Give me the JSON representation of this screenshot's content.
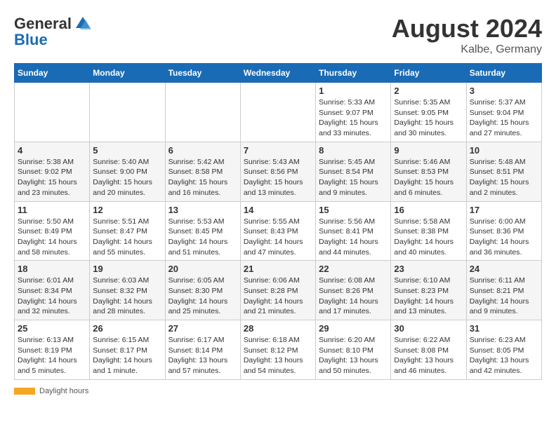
{
  "logo": {
    "general": "General",
    "blue": "Blue"
  },
  "title": "August 2024",
  "location": "Kalbe, Germany",
  "days_of_week": [
    "Sunday",
    "Monday",
    "Tuesday",
    "Wednesday",
    "Thursday",
    "Friday",
    "Saturday"
  ],
  "footer": {
    "daylight_label": "Daylight hours"
  },
  "weeks": [
    [
      {
        "day": "",
        "info": ""
      },
      {
        "day": "",
        "info": ""
      },
      {
        "day": "",
        "info": ""
      },
      {
        "day": "",
        "info": ""
      },
      {
        "day": "1",
        "info": "Sunrise: 5:33 AM\nSunset: 9:07 PM\nDaylight: 15 hours\nand 33 minutes."
      },
      {
        "day": "2",
        "info": "Sunrise: 5:35 AM\nSunset: 9:05 PM\nDaylight: 15 hours\nand 30 minutes."
      },
      {
        "day": "3",
        "info": "Sunrise: 5:37 AM\nSunset: 9:04 PM\nDaylight: 15 hours\nand 27 minutes."
      }
    ],
    [
      {
        "day": "4",
        "info": "Sunrise: 5:38 AM\nSunset: 9:02 PM\nDaylight: 15 hours\nand 23 minutes."
      },
      {
        "day": "5",
        "info": "Sunrise: 5:40 AM\nSunset: 9:00 PM\nDaylight: 15 hours\nand 20 minutes."
      },
      {
        "day": "6",
        "info": "Sunrise: 5:42 AM\nSunset: 8:58 PM\nDaylight: 15 hours\nand 16 minutes."
      },
      {
        "day": "7",
        "info": "Sunrise: 5:43 AM\nSunset: 8:56 PM\nDaylight: 15 hours\nand 13 minutes."
      },
      {
        "day": "8",
        "info": "Sunrise: 5:45 AM\nSunset: 8:54 PM\nDaylight: 15 hours\nand 9 minutes."
      },
      {
        "day": "9",
        "info": "Sunrise: 5:46 AM\nSunset: 8:53 PM\nDaylight: 15 hours\nand 6 minutes."
      },
      {
        "day": "10",
        "info": "Sunrise: 5:48 AM\nSunset: 8:51 PM\nDaylight: 15 hours\nand 2 minutes."
      }
    ],
    [
      {
        "day": "11",
        "info": "Sunrise: 5:50 AM\nSunset: 8:49 PM\nDaylight: 14 hours\nand 58 minutes."
      },
      {
        "day": "12",
        "info": "Sunrise: 5:51 AM\nSunset: 8:47 PM\nDaylight: 14 hours\nand 55 minutes."
      },
      {
        "day": "13",
        "info": "Sunrise: 5:53 AM\nSunset: 8:45 PM\nDaylight: 14 hours\nand 51 minutes."
      },
      {
        "day": "14",
        "info": "Sunrise: 5:55 AM\nSunset: 8:43 PM\nDaylight: 14 hours\nand 47 minutes."
      },
      {
        "day": "15",
        "info": "Sunrise: 5:56 AM\nSunset: 8:41 PM\nDaylight: 14 hours\nand 44 minutes."
      },
      {
        "day": "16",
        "info": "Sunrise: 5:58 AM\nSunset: 8:38 PM\nDaylight: 14 hours\nand 40 minutes."
      },
      {
        "day": "17",
        "info": "Sunrise: 6:00 AM\nSunset: 8:36 PM\nDaylight: 14 hours\nand 36 minutes."
      }
    ],
    [
      {
        "day": "18",
        "info": "Sunrise: 6:01 AM\nSunset: 8:34 PM\nDaylight: 14 hours\nand 32 minutes."
      },
      {
        "day": "19",
        "info": "Sunrise: 6:03 AM\nSunset: 8:32 PM\nDaylight: 14 hours\nand 28 minutes."
      },
      {
        "day": "20",
        "info": "Sunrise: 6:05 AM\nSunset: 8:30 PM\nDaylight: 14 hours\nand 25 minutes."
      },
      {
        "day": "21",
        "info": "Sunrise: 6:06 AM\nSunset: 8:28 PM\nDaylight: 14 hours\nand 21 minutes."
      },
      {
        "day": "22",
        "info": "Sunrise: 6:08 AM\nSunset: 8:26 PM\nDaylight: 14 hours\nand 17 minutes."
      },
      {
        "day": "23",
        "info": "Sunrise: 6:10 AM\nSunset: 8:23 PM\nDaylight: 14 hours\nand 13 minutes."
      },
      {
        "day": "24",
        "info": "Sunrise: 6:11 AM\nSunset: 8:21 PM\nDaylight: 14 hours\nand 9 minutes."
      }
    ],
    [
      {
        "day": "25",
        "info": "Sunrise: 6:13 AM\nSunset: 8:19 PM\nDaylight: 14 hours\nand 5 minutes."
      },
      {
        "day": "26",
        "info": "Sunrise: 6:15 AM\nSunset: 8:17 PM\nDaylight: 14 hours\nand 1 minute."
      },
      {
        "day": "27",
        "info": "Sunrise: 6:17 AM\nSunset: 8:14 PM\nDaylight: 13 hours\nand 57 minutes."
      },
      {
        "day": "28",
        "info": "Sunrise: 6:18 AM\nSunset: 8:12 PM\nDaylight: 13 hours\nand 54 minutes."
      },
      {
        "day": "29",
        "info": "Sunrise: 6:20 AM\nSunset: 8:10 PM\nDaylight: 13 hours\nand 50 minutes."
      },
      {
        "day": "30",
        "info": "Sunrise: 6:22 AM\nSunset: 8:08 PM\nDaylight: 13 hours\nand 46 minutes."
      },
      {
        "day": "31",
        "info": "Sunrise: 6:23 AM\nSunset: 8:05 PM\nDaylight: 13 hours\nand 42 minutes."
      }
    ]
  ]
}
